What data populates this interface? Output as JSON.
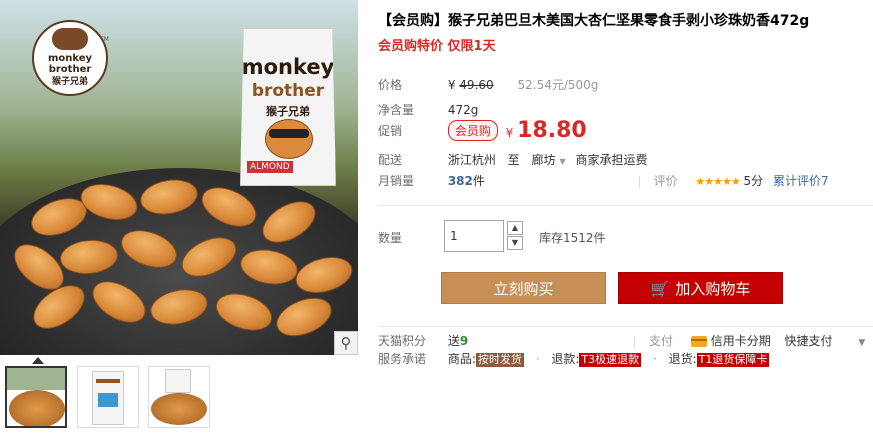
{
  "product": {
    "title": "【会员购】猴子兄弟巴旦木美国大杏仁坚果零食手剥小珍珠奶香472g",
    "subtitle": "会员购特价 仅限1天"
  },
  "gallery": {
    "logo_line1": "monkey",
    "logo_line2": "brother",
    "logo_cn": "猴子兄弟",
    "logo_tm": "TM",
    "bag_line1": "monkey",
    "bag_line2": "brother",
    "bag_cn": "猴子兄弟",
    "bag_tag": "ALMOND",
    "zoom_icon": "magnifier-icon",
    "thumbnails": [
      "thumb-1",
      "thumb-2",
      "thumb-3"
    ]
  },
  "price": {
    "label": "价格",
    "currency": "¥",
    "original": "49.60",
    "unit_price": "52.54元/500g"
  },
  "weight": {
    "label": "净含量",
    "value": "472g"
  },
  "promo": {
    "label": "促销",
    "badge": "会员购",
    "currency": "¥",
    "price": "18.80"
  },
  "shipping": {
    "label": "配送",
    "from": "浙江杭州",
    "to_word": "至",
    "to": "廊坊",
    "fee": "商家承担运费"
  },
  "sales": {
    "label": "月销量",
    "count": "382",
    "unit": "件",
    "rating_label": "评价",
    "stars": "★★★★★",
    "score": "5分",
    "total_reviews": "累计评价7"
  },
  "quantity": {
    "label": "数量",
    "value": "1",
    "stock": "库存1512件"
  },
  "actions": {
    "buy_now": "立刻购买",
    "add_to_cart": "加入购物车"
  },
  "points": {
    "label": "天猫积分",
    "send": "送",
    "value": "9",
    "pay_label": "支付",
    "credit": "信用卡分期",
    "quick_pay": "快捷支付"
  },
  "service": {
    "label": "服务承诺",
    "goods_prefix": "商品:",
    "goods_tag": "按时发货",
    "refund_prefix": "退款:",
    "refund_tag": "T3极速退款",
    "return_prefix": "退货:",
    "return_tag": "T1退货保障卡"
  },
  "colors": {
    "accent": "#dd2727",
    "buy_button": "#c58f55",
    "cart_button": "#c40000",
    "star": "#ff9a00"
  }
}
